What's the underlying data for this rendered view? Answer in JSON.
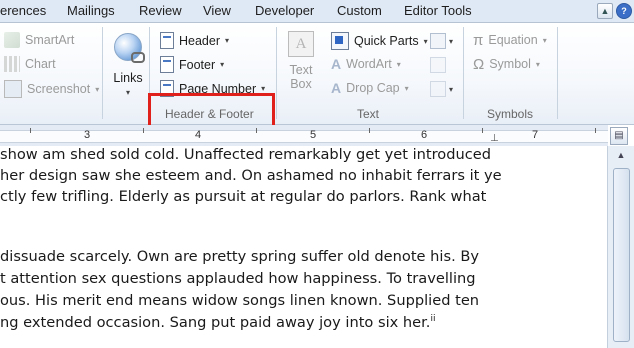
{
  "tabs": [
    "erences",
    "Mailings",
    "Review",
    "View",
    "Developer",
    "Custom",
    "Editor Tools"
  ],
  "window_buttons": {
    "collapse": "▲",
    "help": "?"
  },
  "ribbon": {
    "illustrations": {
      "smartart": "SmartArt",
      "chart": "Chart",
      "screenshot": "Screenshot"
    },
    "links": {
      "label": "Links"
    },
    "header_footer": {
      "header": "Header",
      "footer": "Footer",
      "page_number": "Page Number",
      "group_label": "Header & Footer"
    },
    "text": {
      "text_box_line1": "Text",
      "text_box_line2": "Box",
      "quick_parts": "Quick Parts",
      "wordart": "WordArt",
      "drop_cap": "Drop Cap",
      "group_label": "Text"
    },
    "symbols": {
      "equation": "Equation",
      "symbol": "Symbol",
      "group_label": "Symbols",
      "equation_glyph": "π",
      "symbol_glyph": "Ω"
    }
  },
  "ruler": {
    "numbers": [
      "3",
      "4",
      "5",
      "6",
      "7"
    ]
  },
  "document": {
    "lines": [
      "show am shed sold cold. Unaffected remarkably get yet introduced",
      "her design saw she esteem and. On ashamed no inhabit ferrars it ye",
      "ctly few trifling. Elderly as pursuit at regular do parlors. Rank what",
      "",
      " dissuade scarcely. Own are pretty spring suffer old denote his. By",
      "t attention sex questions applauded how happiness.  To travelling",
      "ous. His merit end means widow songs linen known. Supplied ten",
      "ng extended occasion. Sang put paid away joy into six her."
    ],
    "footnote_mark": "ii"
  }
}
